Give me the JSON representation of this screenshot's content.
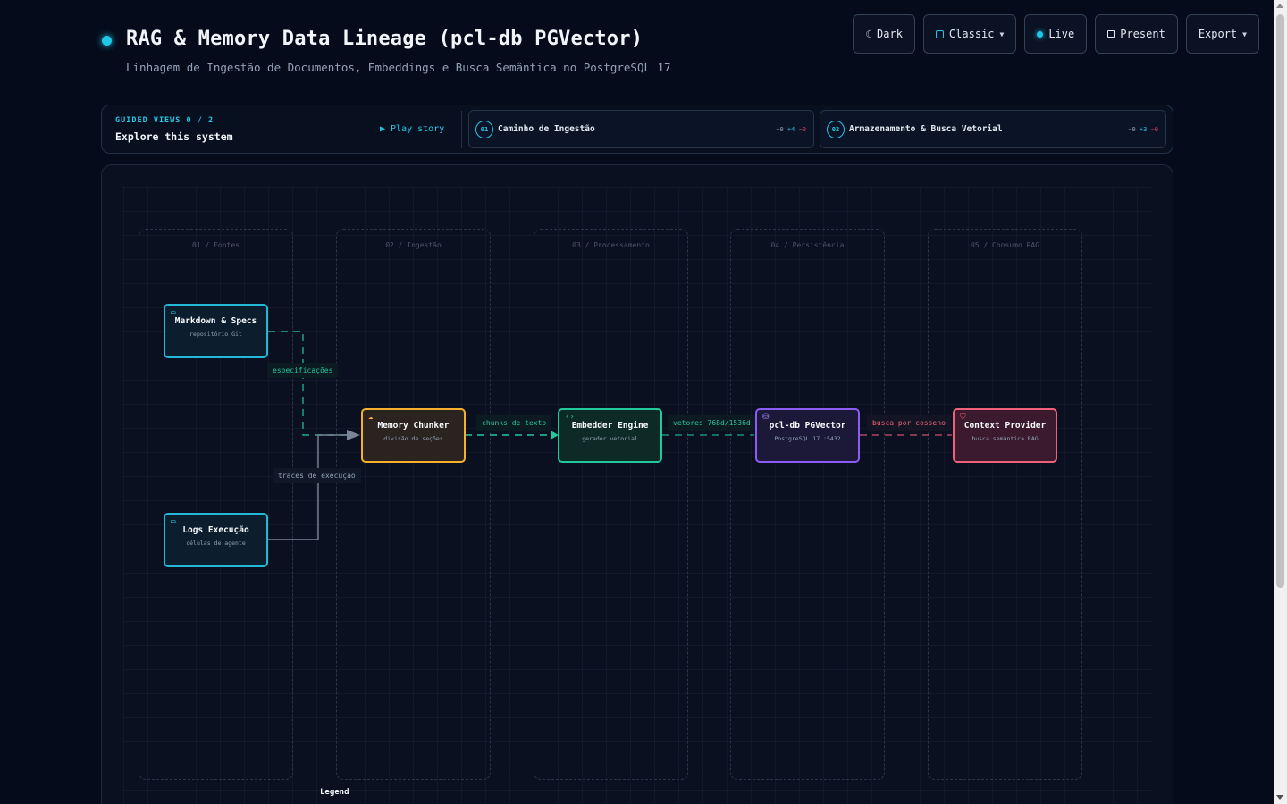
{
  "header": {
    "title": "RAG & Memory Data Lineage (pcl-db PGVector)",
    "subtitle": "Linhagem de Ingestão de Documentos, Embeddings e Busca Semântica no PostgreSQL 17"
  },
  "toolbar": {
    "dark_label": "Dark",
    "classic_label": "Classic",
    "live_label": "Live",
    "present_label": "Present",
    "export_label": "Export"
  },
  "guided": {
    "kicker": "GUIDED VIEWS 0 / 2",
    "explore": "Explore this system",
    "play": "▶ Play story",
    "views": [
      {
        "num": "01",
        "name": "Caminho de Ingestão",
        "d0": "−0",
        "dp": "+4",
        "dm": "−0"
      },
      {
        "num": "02",
        "name": "Armazenamento & Busca Vetorial",
        "d0": "−0",
        "dp": "+3",
        "dm": "−0"
      }
    ]
  },
  "lanes": [
    "01 / Fontes",
    "02 / Ingestão",
    "03 / Processamento",
    "04 / Persistência",
    "05 / Consumo RAG"
  ],
  "nodes": {
    "markdown": {
      "title": "Markdown & Specs",
      "sub": "repositório Git",
      "icon": "file-icon"
    },
    "logs": {
      "title": "Logs Execução",
      "sub": "células de agente",
      "icon": "file-icon"
    },
    "chunker": {
      "title": "Memory Chunker",
      "sub": "divisão de seções",
      "icon": "cloud-icon"
    },
    "embedder": {
      "title": "Embedder Engine",
      "sub": "gerador vetorial",
      "icon": "code-icon"
    },
    "pgvector": {
      "title": "pcl-db PGVector",
      "sub": "PostgreSQL 17 :5432",
      "icon": "database-icon"
    },
    "context": {
      "title": "Context Provider",
      "sub": "busca semântica RAG",
      "icon": "shield-icon"
    }
  },
  "edges": {
    "especificacoes": "especificações",
    "traces": "traces de execução",
    "chunks": "chunks de texto",
    "vetores": "vetores 768d/1536d",
    "busca": "busca por cosseno"
  },
  "legend": "Legend",
  "colors": {
    "accent": "#22c6e6",
    "green": "#22c89a",
    "amber": "#f5b02e",
    "purple": "#8b5cf6",
    "red": "#f0607a",
    "background": "#050b1a"
  }
}
